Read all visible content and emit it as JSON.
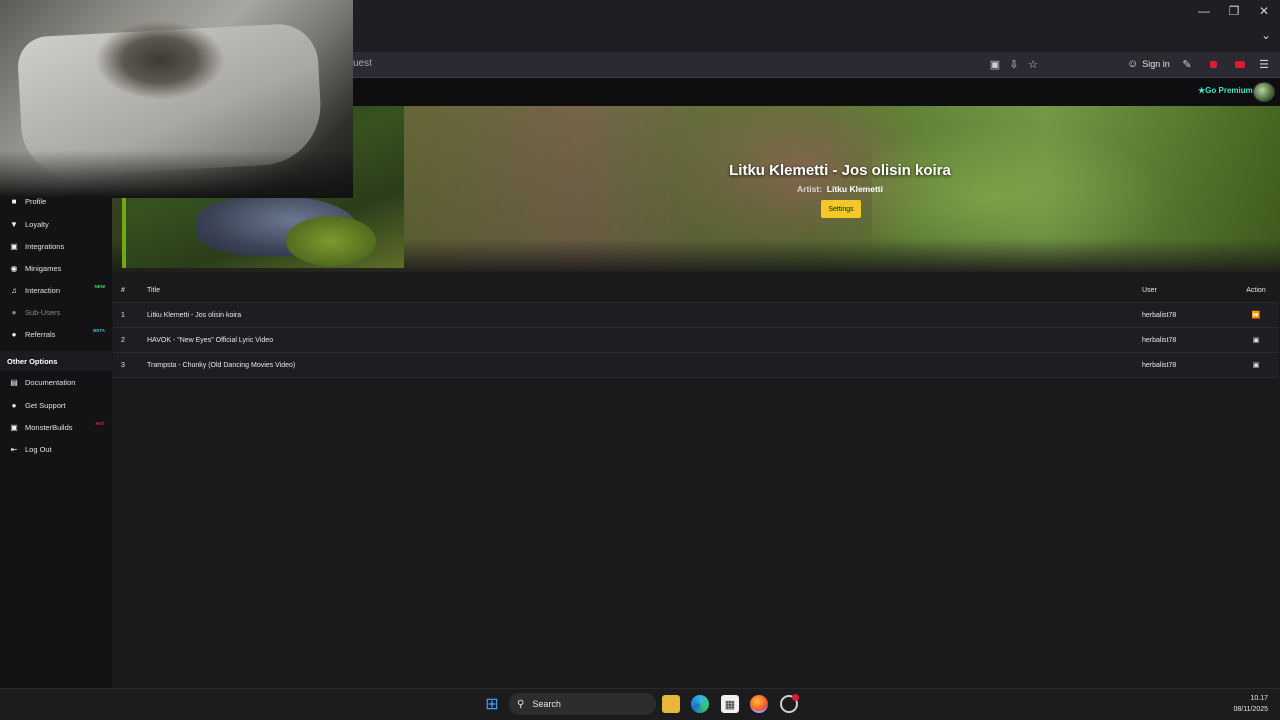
{
  "browser": {
    "url_partial": "uest",
    "sign_in_label": "Sign in",
    "window_controls": [
      "minimize",
      "restore",
      "close"
    ]
  },
  "site_header": {
    "premium_label": "Go Premium"
  },
  "hero": {
    "song_title": "Litku Klemetti - Jos olisin koira",
    "artist_label": "Artist:",
    "artist_name": "Litku Klemetti",
    "settings_label": "Settings",
    "accent_color": "#f2c927"
  },
  "sidebar": {
    "items": [
      {
        "label": "Profile",
        "icon": "user-icon"
      },
      {
        "label": "Loyalty",
        "icon": "trophy-icon"
      },
      {
        "label": "Integrations",
        "icon": "plug-icon"
      },
      {
        "label": "Minigames",
        "icon": "gamepad-icon"
      },
      {
        "label": "Interaction",
        "icon": "music-icon",
        "tag": "NEW",
        "tag_color": "#2fe06a"
      },
      {
        "label": "Sub-Users",
        "icon": "users-icon"
      },
      {
        "label": "Referrals",
        "icon": "users-icon",
        "tag": "BETA",
        "tag_color": "#3fb8e6"
      }
    ],
    "other_heading": "Other Options",
    "other_items": [
      {
        "label": "Documentation",
        "icon": "document-icon"
      },
      {
        "label": "Get Support",
        "icon": "support-icon"
      },
      {
        "label": "MonsterBuilds",
        "icon": "laptop-icon",
        "tag": "HOT",
        "tag_color": "#e0203a"
      },
      {
        "label": "Log Out",
        "icon": "logout-icon"
      }
    ]
  },
  "queue_table": {
    "headers": {
      "num": "#",
      "title": "Title",
      "user": "User",
      "action": "Action"
    },
    "rows": [
      {
        "num": "1",
        "title": "Litku Klemetti - Jos olisin koira",
        "user": "herbalist78",
        "action": "skip-icon"
      },
      {
        "num": "2",
        "title": "HAVOK - \"New Eyes\" Official Lyric Video",
        "user": "herbalist78",
        "action": "trash-icon"
      },
      {
        "num": "3",
        "title": "Trampsta - Chunky (Old Dancing Movies Video)",
        "user": "herbalist78",
        "action": "trash-icon"
      }
    ]
  },
  "taskbar": {
    "search_label": "Search",
    "time": "10.17",
    "date": "08/11/2025"
  }
}
